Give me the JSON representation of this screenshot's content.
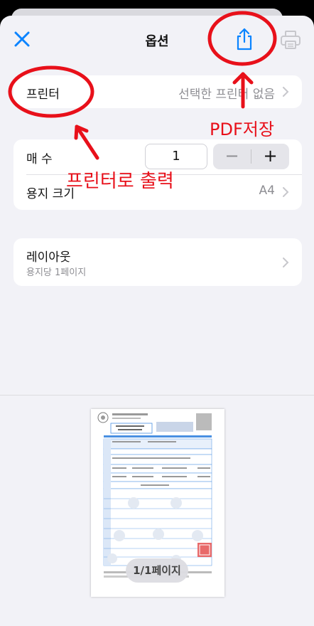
{
  "header": {
    "title": "옵션"
  },
  "printer_row": {
    "label": "프린터",
    "value": "선택한 프린터 없음"
  },
  "copies_row": {
    "label": "매 수",
    "value": "1",
    "minus": "−",
    "plus": "+"
  },
  "paper_row": {
    "label": "용지 크기",
    "value": "A4"
  },
  "layout_row": {
    "label": "레이아웃",
    "subtext": "용지당 1페이지"
  },
  "preview": {
    "page_indicator": "1/1페이지"
  },
  "annotations": {
    "pdf_save": "PDF저장",
    "print_output": "프린터로 출력"
  },
  "colors": {
    "accent": "#0a84ff",
    "annotation_red": "#e8101a",
    "sheet_bg": "#f2f2f7"
  }
}
